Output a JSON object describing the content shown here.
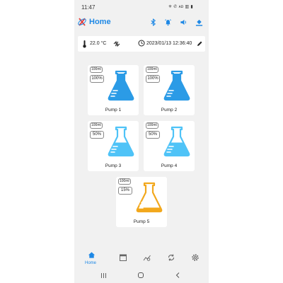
{
  "status_bar": {
    "time": "11:47",
    "system_icons": "✳ ✆ ᴀᴅ ▥ ▮"
  },
  "app_bar": {
    "title": "Home",
    "icons": [
      "bluetooth-icon",
      "alarm-bell-icon",
      "volume-icon",
      "fill-bucket-icon"
    ]
  },
  "info_bar": {
    "temperature": "22.0 °C",
    "datetime": "2023/01/13 12:36:40"
  },
  "pumps": [
    {
      "name": "Pump 1",
      "volume": "100ml",
      "percent": "100%",
      "level": 1.0,
      "color": "#2b9be6"
    },
    {
      "name": "Pump 2",
      "volume": "100ml",
      "percent": "100%",
      "level": 1.0,
      "color": "#2b9be6"
    },
    {
      "name": "Pump 3",
      "volume": "100ml",
      "percent": "50%",
      "level": 0.5,
      "color": "#4fc3f7"
    },
    {
      "name": "Pump 4",
      "volume": "100ml",
      "percent": "50%",
      "level": 0.5,
      "color": "#4fc3f7"
    },
    {
      "name": "Pump 5",
      "volume": "100ml",
      "percent": "15%",
      "level": 0.15,
      "color": "#f2a81d"
    }
  ],
  "bottom_nav": {
    "active_label": "Home",
    "items": [
      "home-icon",
      "calendar-icon",
      "chart-icon",
      "sync-icon",
      "settings-icon"
    ]
  },
  "colors": {
    "accent": "#1e88e5",
    "background": "#f1f1f1"
  }
}
